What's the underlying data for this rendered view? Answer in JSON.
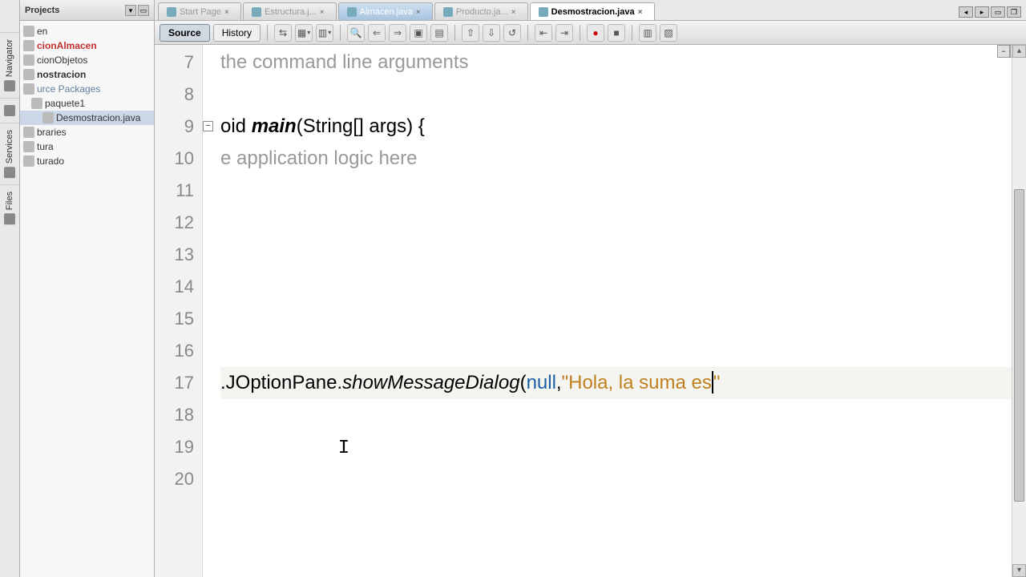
{
  "vtabs": [
    "Navigator",
    "",
    "Services",
    "Files"
  ],
  "projectsPanel": {
    "title": "Projects"
  },
  "tree": [
    {
      "label": "en",
      "cls": "",
      "indent": 0
    },
    {
      "label": "cionAlmacen",
      "cls": "red",
      "indent": 0
    },
    {
      "label": "cionObjetos",
      "cls": "",
      "indent": 0
    },
    {
      "label": "nostracion",
      "cls": "bold",
      "indent": 0
    },
    {
      "label": "urce Packages",
      "cls": "blue",
      "indent": 0
    },
    {
      "label": "paquete1",
      "cls": "",
      "indent": 1
    },
    {
      "label": "Desmostracion.java",
      "cls": "selected",
      "indent": 2
    },
    {
      "label": "braries",
      "cls": "",
      "indent": 0
    },
    {
      "label": "tura",
      "cls": "",
      "indent": 0
    },
    {
      "label": "turado",
      "cls": "",
      "indent": 0
    }
  ],
  "fileTabs": [
    {
      "label": "Start Page",
      "active": false,
      "dim": true
    },
    {
      "label": "Estructura.j...",
      "active": false,
      "dim": true
    },
    {
      "label": "Almacen.java",
      "active": false,
      "dim": false,
      "highlight": true
    },
    {
      "label": "Producto.ja...",
      "active": false,
      "dim": true
    },
    {
      "label": "Desmostracion.java",
      "active": true,
      "dim": false
    }
  ],
  "subTabs": {
    "source": "Source",
    "history": "History"
  },
  "gutter": [
    "7",
    "8",
    "9",
    "10",
    "11",
    "12",
    "13",
    "14",
    "15",
    "16",
    "17",
    "18",
    "19",
    "20"
  ],
  "code": {
    "l7": "the command line arguments",
    "l8": "",
    "l9_a": "oid ",
    "l9_b": "main",
    "l9_c": "(String[] args) {",
    "l10": "e application logic here",
    "l11": "",
    "l12": "",
    "l13": "",
    "l14": "",
    "l15": "",
    "l16": "",
    "l17_a": ".JOptionPane.",
    "l17_b": "showMessageDialog",
    "l17_c": "(",
    "l17_d": "null",
    "l17_e": ",",
    "l17_f": "\"Hola, la suma es",
    "l17_g": "\"",
    "l18": "",
    "l19": "",
    "l20": ""
  },
  "textCursor": "I"
}
